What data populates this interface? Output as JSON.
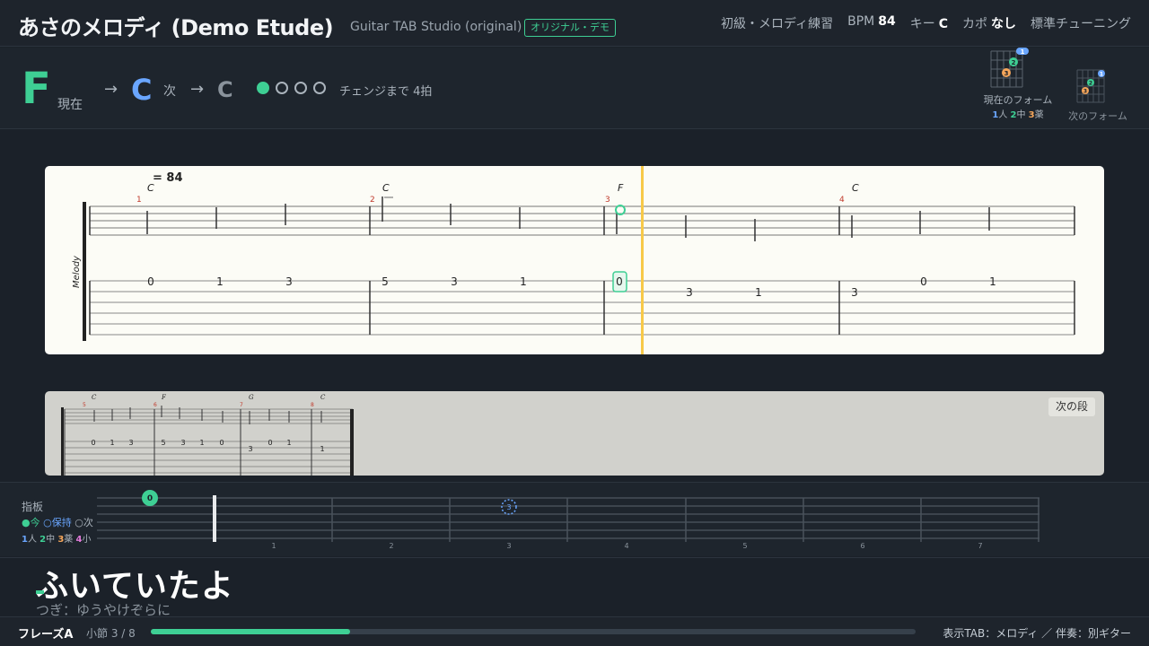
{
  "header": {
    "title": "あさのメロディ (Demo Etude)",
    "subtitle": "Guitar TAB Studio (original)",
    "badge": "オリジナル・デモ",
    "level": "初級・メロディ練習",
    "bpm_label": "BPM",
    "bpm_value": "84",
    "key_label": "キー",
    "key_value": "C",
    "capo_label": "カポ",
    "capo_value": "なし",
    "tuning": "標準チューニング"
  },
  "chordbar": {
    "current_chord": "F",
    "current_label": "現在",
    "arrow": "→",
    "next_chord": "C",
    "next_label": "次",
    "after_chord": "C",
    "beats_total": 4,
    "beats_done": 1,
    "change_text": "チェンジまで 4拍",
    "current_form_label": "現在のフォーム",
    "next_form_label": "次のフォーム",
    "finger_legend": [
      {
        "num": "1",
        "name": "人"
      },
      {
        "num": "2",
        "name": "中"
      },
      {
        "num": "3",
        "name": "薬"
      }
    ],
    "colors": {
      "finger1": "#6aa6ff",
      "finger2": "#3ecf94",
      "finger3": "#f5a65b",
      "finger4": "#e07ad9"
    }
  },
  "score": {
    "tempo_text": "= 84",
    "track_label": "Melody",
    "measures": [
      {
        "number": "1",
        "chord": "C",
        "tab": [
          "0",
          "1",
          "3"
        ]
      },
      {
        "number": "2",
        "chord": "C",
        "tab": [
          "5",
          "3",
          "1"
        ]
      },
      {
        "number": "3",
        "chord": "F",
        "tab": [
          "0",
          "3",
          "1"
        ]
      },
      {
        "number": "4",
        "chord": "C",
        "tab": [
          "3",
          "0",
          "1"
        ]
      }
    ]
  },
  "preview": {
    "button": "次の段",
    "measures": [
      {
        "number": "5",
        "chord": "C",
        "tab": [
          "0",
          "1",
          "3"
        ]
      },
      {
        "number": "6",
        "chord": "F",
        "tab": [
          "5",
          "3",
          "1",
          "0"
        ]
      },
      {
        "number": "7",
        "chord": "G",
        "tab": [
          "3",
          "0",
          "1"
        ]
      },
      {
        "number": "8",
        "chord": "C",
        "tab": [
          "1"
        ]
      }
    ]
  },
  "fretboard": {
    "title": "指板",
    "legend_now": "●今",
    "legend_hold": "○保持",
    "legend_next": "○次",
    "finger_legend": [
      {
        "num": "1",
        "name": "人"
      },
      {
        "num": "2",
        "name": "中"
      },
      {
        "num": "3",
        "name": "薬"
      },
      {
        "num": "4",
        "name": "小"
      }
    ],
    "fret_numbers": [
      "1",
      "2",
      "3",
      "4",
      "5",
      "6",
      "7"
    ],
    "current_marker": "0",
    "next_marker": "3"
  },
  "lyrics": {
    "current": "ふいていたよ",
    "next": "つぎ：ゆうやけぞらに"
  },
  "footer": {
    "phrase": "フレーズA",
    "measure": "小節 3 / 8",
    "progress": 0.26,
    "right_text": "表示TAB：メロディ ／ 伴奏：別ギター"
  }
}
